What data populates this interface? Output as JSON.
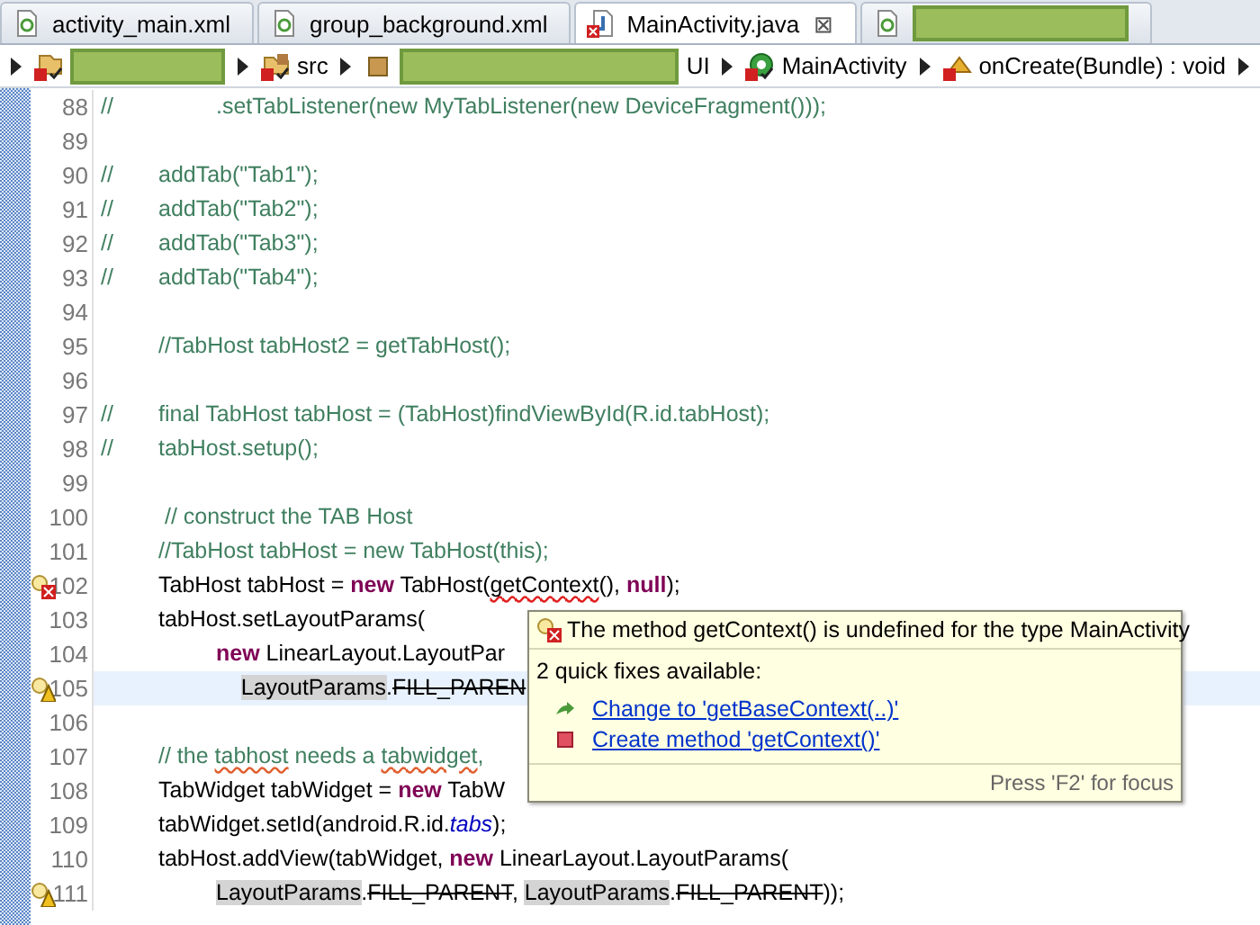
{
  "tabs": [
    {
      "label": "activity_main.xml",
      "kind": "xml",
      "selected": false,
      "redacted": false
    },
    {
      "label": "group_background.xml",
      "kind": "xml",
      "selected": false,
      "redacted": false
    },
    {
      "label": "MainActivity.java",
      "kind": "java-error",
      "selected": true,
      "redacted": false,
      "close": "⊠"
    },
    {
      "kind": "xml",
      "selected": false,
      "redacted": true
    }
  ],
  "breadcrumb": [
    {
      "kind": "project",
      "redacted": true
    },
    {
      "kind": "folder",
      "label": "src",
      "redacted": false
    },
    {
      "kind": "package",
      "label": "UI",
      "redacted": true
    },
    {
      "kind": "class",
      "label": "MainActivity",
      "redacted": false
    },
    {
      "kind": "method",
      "label": "onCreate(Bundle) : void",
      "redacted": false
    }
  ],
  "lines": [
    {
      "number": "88",
      "kind": "plain",
      "current": false,
      "segments": [
        {
          "text": "//\t\t.setTabListener(new MyTabListener(new DeviceFragment()));",
          "kind": "comment"
        }
      ]
    },
    {
      "number": "89",
      "kind": "plain",
      "current": false
    },
    {
      "number": "90",
      "kind": "plain",
      "current": false,
      "segments": [
        {
          "text": "//\taddTab(\"Tab1\");",
          "kind": "comment"
        }
      ]
    },
    {
      "number": "91",
      "kind": "plain",
      "current": false,
      "segments": [
        {
          "text": "//\taddTab(\"Tab2\");",
          "kind": "comment"
        }
      ]
    },
    {
      "number": "92",
      "kind": "plain",
      "current": false,
      "segments": [
        {
          "text": "//\taddTab(\"Tab3\");",
          "kind": "comment"
        }
      ]
    },
    {
      "number": "93",
      "kind": "plain",
      "current": false,
      "segments": [
        {
          "text": "//\taddTab(\"Tab4\");",
          "kind": "comment"
        }
      ]
    },
    {
      "number": "94",
      "kind": "plain",
      "current": false
    },
    {
      "number": "95",
      "kind": "plain",
      "current": false,
      "segments": [
        {
          "text": "\t//TabHost tabHost2 = getTabHost();",
          "kind": "comment"
        }
      ]
    },
    {
      "number": "96",
      "kind": "plain",
      "current": false
    },
    {
      "number": "97",
      "kind": "plain",
      "current": false,
      "segments": [
        {
          "text": "//\tfinal TabHost tabHost = (TabHost)findViewById(R.id.tabHost);",
          "kind": "comment"
        }
      ]
    },
    {
      "number": "98",
      "kind": "plain",
      "current": false,
      "segments": [
        {
          "text": "//\ttabHost.setup();",
          "kind": "comment"
        }
      ]
    },
    {
      "number": "99",
      "kind": "plain",
      "current": false
    },
    {
      "number": "100",
      "kind": "plain",
      "current": false,
      "segments": [
        {
          "text": "\t // construct the TAB Host",
          "kind": "comment"
        }
      ]
    },
    {
      "number": "101",
      "kind": "plain",
      "current": false,
      "segments": [
        {
          "text": "\t//TabHost tabHost = new TabHost(this);",
          "kind": "comment"
        }
      ]
    },
    {
      "number": "102",
      "kind": "error",
      "current": false,
      "segments": [
        {
          "text": "\tTabHost tabHost = ",
          "kind": "code"
        },
        {
          "text": "new",
          "kind": "keyword"
        },
        {
          "text": " TabHost(",
          "kind": "code"
        },
        {
          "text": "getContext",
          "kind": "error"
        },
        {
          "text": "(), ",
          "kind": "code"
        },
        {
          "text": "null",
          "kind": "keyword"
        },
        {
          "text": ");",
          "kind": "code"
        }
      ]
    },
    {
      "number": "103",
      "kind": "plain",
      "current": false,
      "segments": [
        {
          "text": "\ttabHost.setLayoutParams(",
          "kind": "code"
        }
      ]
    },
    {
      "number": "104",
      "kind": "plain",
      "current": false,
      "segments": [
        {
          "text": "\t\tnew",
          "kind": "keyword"
        },
        {
          "text": " LinearLayout.LayoutPar",
          "kind": "code"
        }
      ]
    },
    {
      "number": "105",
      "kind": "warning",
      "current": true,
      "segments": [
        {
          "text": "\t\t    LayoutParams",
          "kind": "occurrence"
        },
        {
          "text": ".",
          "kind": "code"
        },
        {
          "text": "FILL_PAREN",
          "kind": "deprecated"
        }
      ]
    },
    {
      "number": "106",
      "kind": "plain",
      "current": false
    },
    {
      "number": "107",
      "kind": "plain",
      "current": false,
      "segments": [
        {
          "text": "\t// the ",
          "kind": "comment"
        },
        {
          "text": "tabhost",
          "kind": "spelling"
        },
        {
          "text": " needs a ",
          "kind": "comment"
        },
        {
          "text": "tabwidget",
          "kind": "spelling"
        },
        {
          "text": ",",
          "kind": "comment"
        }
      ]
    },
    {
      "number": "108",
      "kind": "plain",
      "current": false,
      "segments": [
        {
          "text": "\tTabWidget tabWidget = ",
          "kind": "code"
        },
        {
          "text": "new",
          "kind": "keyword"
        },
        {
          "text": " TabW",
          "kind": "code"
        }
      ]
    },
    {
      "number": "109",
      "kind": "plain",
      "current": false,
      "segments": [
        {
          "text": "\ttabWidget.setId(android.R.id.",
          "kind": "code"
        },
        {
          "text": "tabs",
          "kind": "field"
        },
        {
          "text": ");",
          "kind": "code"
        }
      ]
    },
    {
      "number": "110",
      "kind": "plain",
      "current": false,
      "segments": [
        {
          "text": "\ttabHost.addView(tabWidget, ",
          "kind": "code"
        },
        {
          "text": "new",
          "kind": "keyword"
        },
        {
          "text": " LinearLayout.LayoutParams(",
          "kind": "code"
        }
      ]
    },
    {
      "number": "111",
      "kind": "warning",
      "current": false,
      "segments": [
        {
          "text": "\t\tLayoutParams",
          "kind": "occurrence"
        },
        {
          "text": ".",
          "kind": "code"
        },
        {
          "text": "FILL_PARENT",
          "kind": "deprecated"
        },
        {
          "text": ", ",
          "kind": "code"
        },
        {
          "text": "LayoutParams",
          "kind": "occurrence"
        },
        {
          "text": ".",
          "kind": "code"
        },
        {
          "text": "FILL_PARENT",
          "kind": "deprecated"
        },
        {
          "text": "));",
          "kind": "code"
        }
      ]
    }
  ],
  "tooltip": {
    "message": "The method getContext() is undefined for the type MainActivity",
    "summary": "2 quick fixes available:",
    "fixes": [
      {
        "label": "Change to 'getBaseContext(..)'",
        "kind": "rename"
      },
      {
        "label": "Create method 'getContext()'",
        "kind": "create"
      }
    ],
    "footer": "Press 'F2' for focus"
  }
}
